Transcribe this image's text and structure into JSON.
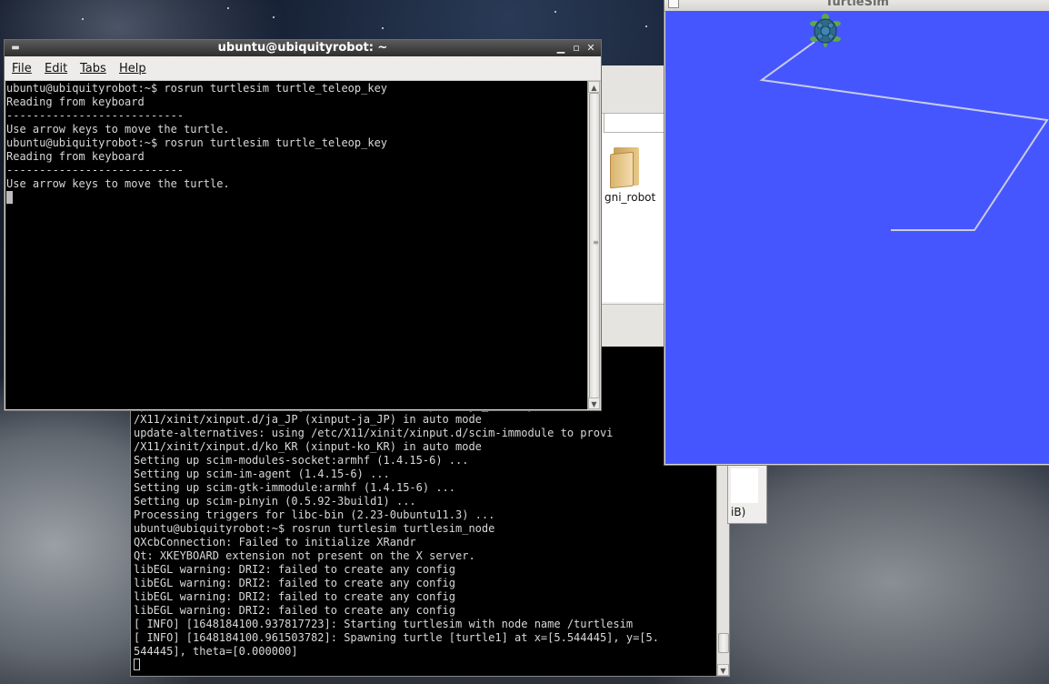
{
  "front_terminal": {
    "title": "ubuntu@ubiquityrobot: ~",
    "menu": [
      "File",
      "Edit",
      "Tabs",
      "Help"
    ],
    "lines": [
      "ubuntu@ubiquityrobot:~$ rosrun turtlesim turtle_teleop_key",
      "Reading from keyboard",
      "---------------------------",
      "Use arrow keys to move the turtle.",
      "ubuntu@ubiquityrobot:~$ rosrun turtlesim turtle_teleop_key",
      "Reading from keyboard",
      "---------------------------",
      "Use arrow keys to move the turtle."
    ]
  },
  "back_terminal": {
    "lines": [
      "update-alternatives: using /etc/X11/xinit/xinput.d/ja_JP to provi",
      "/X11/xinit/xinput.d/ja_JP (xinput-ja_JP) in auto mode",
      "update-alternatives: using /etc/X11/xinit/xinput.d/scim-immodule to provi",
      "/X11/xinit/xinput.d/ko_KR (xinput-ko_KR) in auto mode",
      "Setting up scim-modules-socket:armhf (1.4.15-6) ...",
      "Setting up scim-im-agent (1.4.15-6) ...",
      "Setting up scim-gtk-immodule:armhf (1.4.15-6) ...",
      "Setting up scim-pinyin (0.5.92-3build1) ...",
      "Processing triggers for libc-bin (2.23-0ubuntu11.3) ...",
      "ubuntu@ubiquityrobot:~$ rosrun turtlesim turtlesim_node",
      "QXcbConnection: Failed to initialize XRandr",
      "Qt: XKEYBOARD extension not present on the X server.",
      "libEGL warning: DRI2: failed to create any config",
      "libEGL warning: DRI2: failed to create any config",
      "libEGL warning: DRI2: failed to create any config",
      "libEGL warning: DRI2: failed to create any config",
      "[ INFO] [1648184100.937817723]: Starting turtlesim with node name /turtlesim",
      "[ INFO] [1648184100.961503782]: Spawning turtle [turtle1] at x=[5.544445], y=[5.",
      "544445], theta=[0.000000]"
    ]
  },
  "file_manager": {
    "folder_label": "gni_robot"
  },
  "fragment": {
    "text": "iB)"
  },
  "turtlesim": {
    "title": "TurtleSim",
    "background": "#4556ff",
    "path_color": "#c8cbe6"
  },
  "icons": {
    "window_menu": "terminal-menu-icon",
    "minimize": "minimize-icon",
    "maximize": "maximize-icon",
    "close": "close-icon",
    "turtle": "turtle-icon",
    "folder": "folder-icon"
  }
}
